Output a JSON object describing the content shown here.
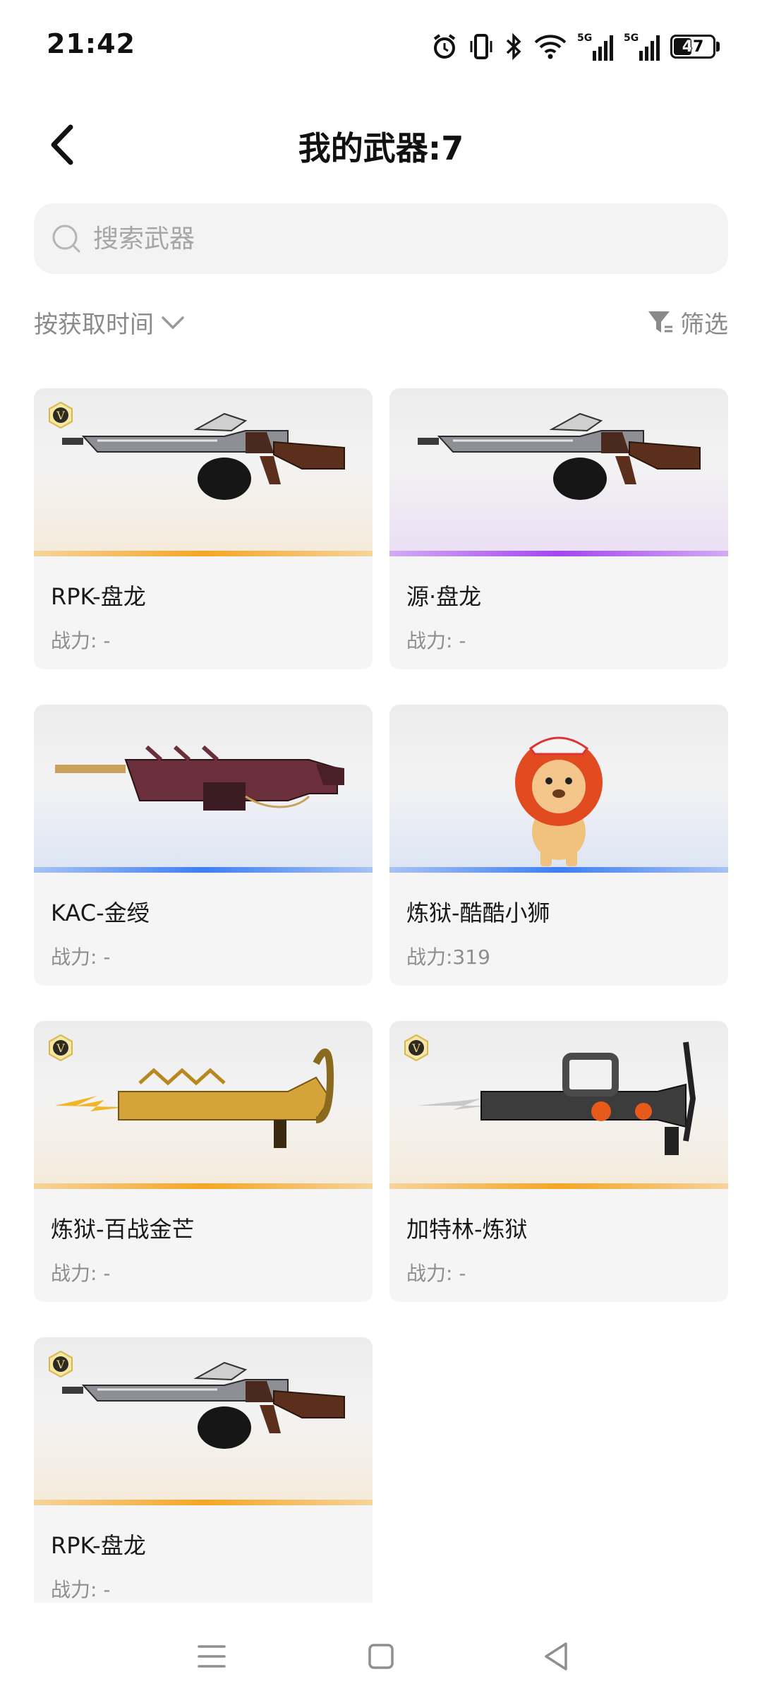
{
  "status_bar": {
    "time": "21:42",
    "battery": "47",
    "battery_level": 0.47,
    "icons": [
      "alarm-icon",
      "vibrate-icon",
      "bluetooth-icon",
      "wifi-icon",
      "signal-5g-icon",
      "signal-5g-icon",
      "battery-icon"
    ]
  },
  "header": {
    "back_icon": "chevron-left-icon",
    "title": "我的武器:7"
  },
  "search": {
    "placeholder": "搜索武器",
    "value": ""
  },
  "sort": {
    "label": "按获取时间",
    "icon": "chevron-down-icon"
  },
  "filter": {
    "label": "筛选",
    "icon": "filter-icon"
  },
  "weapons": [
    {
      "name": "RPK-盘龙",
      "power": "战力: -",
      "tier_color": "#f5a524",
      "vip": true,
      "art": "rifle"
    },
    {
      "name": "源·盘龙",
      "power": "战力: -",
      "tier_color": "#a347f0",
      "vip": false,
      "art": "rifle"
    },
    {
      "name": "KAC-金绶",
      "power": "战力: -",
      "tier_color": "#3e7ef2",
      "vip": false,
      "art": "lmg"
    },
    {
      "name": "炼狱-酷酷小狮",
      "power": "战力:319",
      "tier_color": "#3e7ef2",
      "vip": false,
      "art": "lion"
    },
    {
      "name": "炼狱-百战金芒",
      "power": "战力: -",
      "tier_color": "#f5a524",
      "vip": true,
      "art": "golden"
    },
    {
      "name": "加特林-炼狱",
      "power": "战力: -",
      "tier_color": "#f5a524",
      "vip": true,
      "art": "gatling"
    },
    {
      "name": "RPK-盘龙",
      "power": "战力: -",
      "tier_color": "#f5a524",
      "vip": true,
      "art": "rifle"
    }
  ],
  "nav": {
    "menu_icon": "menu-icon",
    "home_icon": "home-square-icon",
    "back_icon": "back-triangle-icon"
  }
}
